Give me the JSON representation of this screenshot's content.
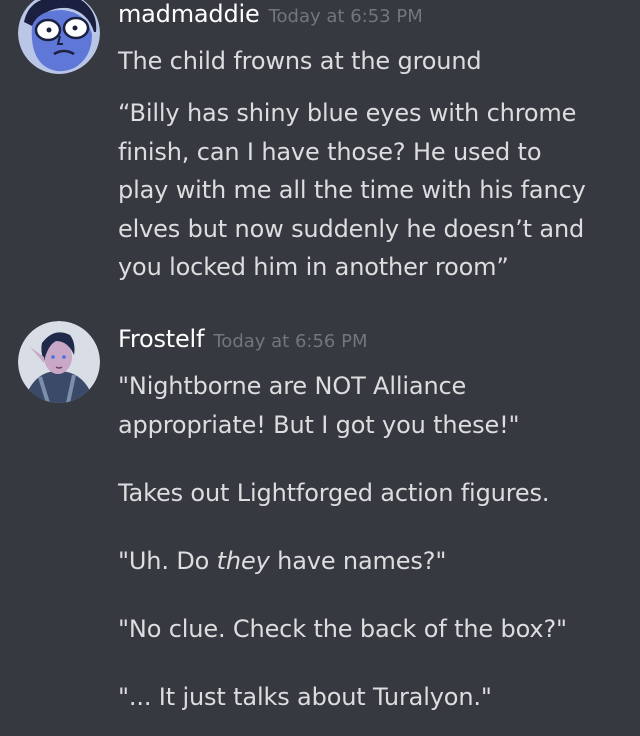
{
  "messages": [
    {
      "username": "madmaddie",
      "timestamp": "Today at 6:53 PM",
      "lines": [
        "The child frowns at the ground",
        "“Billy has shiny blue eyes with chrome",
        "finish, can I have those? He used to",
        "play with me all the time with his fancy",
        "elves but now suddenly he doesn’t and",
        "you locked him in another room”"
      ]
    },
    {
      "username": "Frostelf",
      "timestamp": "Today at 6:56 PM",
      "lines": [
        "\"Nightborne are NOT Alliance",
        "appropriate! But I got you these!\"",
        "Takes out Lightforged action figures.",
        "\"No clue. Check the back of the box?\"",
        "\"... It just talks about Turalyon.\""
      ],
      "uh_line": {
        "before": "\"Uh. Do ",
        "emphasis": "they",
        "after": " have names?\""
      }
    }
  ],
  "colors": {
    "background": "#36393f",
    "username": "#ffffff",
    "timestamp": "#72767d",
    "text": "#dcddde"
  }
}
